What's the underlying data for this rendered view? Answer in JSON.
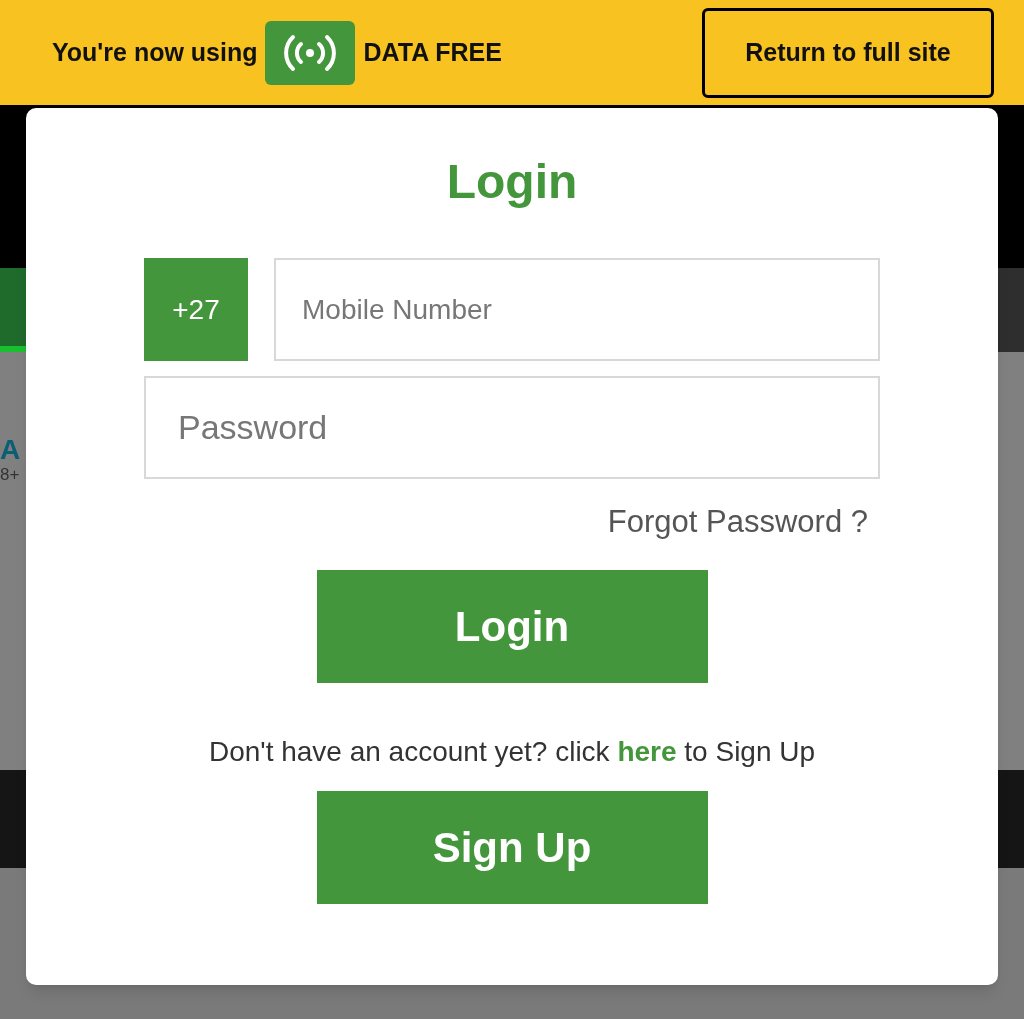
{
  "banner": {
    "text_before": "You're now using",
    "text_after": "DATA FREE",
    "button": "Return to full site"
  },
  "background": {
    "fragments": [
      "A",
      "8+"
    ]
  },
  "login": {
    "title": "Login",
    "country_code": "+27",
    "mobile_placeholder": "Mobile Number",
    "password_placeholder": "Password",
    "forgot_link": "Forgot Password ?",
    "login_button": "Login",
    "prompt_before": "Don't have an account yet? click",
    "prompt_link": "here",
    "prompt_after": "to Sign Up",
    "signup_button": "Sign Up"
  }
}
